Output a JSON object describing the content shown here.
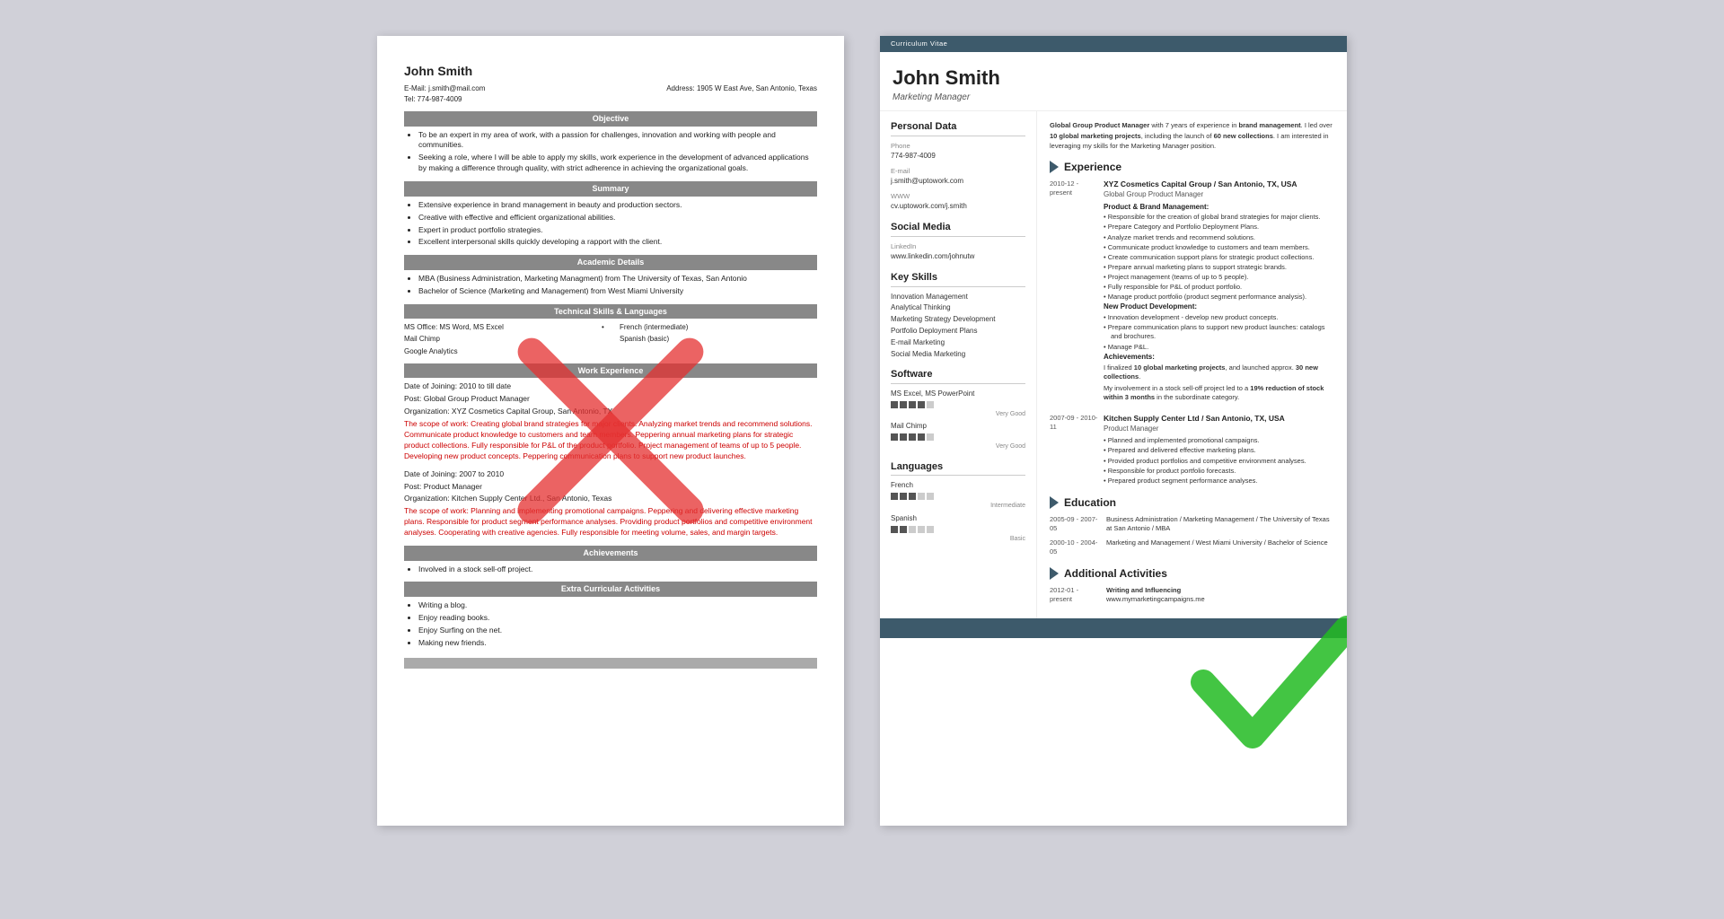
{
  "left_resume": {
    "name": "John Smith",
    "email": "E-Mail: j.smith@mail.com",
    "tel": "Tel: 774-987-4009",
    "address": "Address: 1905 W East Ave, San Antonio, Texas",
    "sections": {
      "objective": {
        "title": "Objective",
        "points": [
          "To be an expert in my area of work, with a passion for challenges, innovation and working with people and communities.",
          "Seeking a role, where I will be able to apply my skills, work experience in the development of advanced applications by making a difference through quality, with strict adherence in achieving the organizational goals."
        ]
      },
      "summary": {
        "title": "Summary",
        "points": [
          "Extensive experience in brand management in beauty and production sectors.",
          "Creative with effective and efficient organizational abilities.",
          "Expert in product portfolio strategies.",
          "Excellent interpersonal skills quickly developing a rapport with the client."
        ]
      },
      "academic": {
        "title": "Academic Details",
        "points": [
          "MBA (Business Administration, Marketing Managment) from The University of Texas, San Antonio",
          "Bachelor of Science (Marketing and Management) from West Miami University"
        ]
      },
      "skills": {
        "title": "Technical Skills & Languages",
        "col1": [
          "MS Office: MS Word, MS Excel",
          "Mail Chimp",
          "Google Analytics"
        ],
        "col2": [
          "French (intermediate)",
          "Spanish (basic)"
        ]
      },
      "work": {
        "title": "Work Experience",
        "jobs": [
          {
            "joining": "Date of Joining: 2010 to till date",
            "post": "Post: Global Group Product Manager",
            "org": "Organization: XYZ Cosmetics Capital Group, San Antonio, TX",
            "scope": "The scope of work: Creating global brand strategies for major clients. Analyzing market trends and recommend solutions. Communicate product knowledge to customers and team members. Peppering annual marketing plans for strategic product collections. Fully responsible for P&L of the product portfolio. Project management of teams of up to 5 people. Developing new product concepts. Peppering communication plans to support new product launches."
          },
          {
            "joining": "Date of Joining: 2007 to 2010",
            "post": "Post: Product Manager",
            "org": "Organization: Kitchen Supply Center Ltd., San Antonio, Texas",
            "scope": "The scope of work: Planning and implementing promotional campaigns. Peppering and delivering effective marketing plans. Responsible for product segment performance analyses. Providing product portfolios and competitive environment analyses. Cooperating with creative agencies. Fully responsible for meeting volume, sales, and margin targets."
          }
        ]
      },
      "achievements": {
        "title": "Achievements",
        "points": [
          "Involved in a stock sell-off project."
        ]
      },
      "extra": {
        "title": "Extra Curricular Activities",
        "points": [
          "Writing a blog.",
          "Enjoy reading books.",
          "Enjoy Surfing on the net.",
          "Making new friends."
        ]
      }
    }
  },
  "right_resume": {
    "cv_label": "Curriculum Vitae",
    "name": "John Smith",
    "title": "Marketing Manager",
    "intro": "Global Group Product Manager with 7 years of experience in brand management. I led over 10 global marketing projects, including the launch of 60 new collections. I am interested in leveraging my skills for the Marketing Manager position.",
    "personal_data": {
      "label": "Personal Data",
      "phone_label": "Phone",
      "phone": "774-987-4009",
      "email_label": "E-mail",
      "email": "j.smith@uptowork.com",
      "www_label": "WWW",
      "www": "cv.uptowork.com/j.smith"
    },
    "social": {
      "label": "Social Media",
      "linkedin_label": "LinkedIn",
      "linkedin": "www.linkedin.com/johnutw"
    },
    "skills": {
      "label": "Key Skills",
      "items": [
        "Innovation Management",
        "Analytical Thinking",
        "Marketing Strategy Development",
        "Portfolio Deployment Plans",
        "E-mail Marketing",
        "Social Media Marketing"
      ]
    },
    "software": {
      "label": "Software",
      "items": [
        {
          "name": "MS Excel, MS PowerPoint",
          "dots": 4,
          "total": 5,
          "level": "Very Good"
        },
        {
          "name": "Mail Chimp",
          "dots": 4,
          "total": 5,
          "level": "Very Good"
        }
      ]
    },
    "languages": {
      "label": "Languages",
      "items": [
        {
          "name": "French",
          "dots": 3,
          "total": 5,
          "level": "Intermediate"
        },
        {
          "name": "Spanish",
          "dots": 2,
          "total": 5,
          "level": "Basic"
        }
      ]
    },
    "experience": {
      "label": "Experience",
      "jobs": [
        {
          "date": "2010-12 - present",
          "company": "XYZ Cosmetics Capital Group / San Antonio, TX, USA",
          "role": "Global Group Product Manager",
          "sections": [
            {
              "subtitle": "Product & Brand Management:",
              "bullets": [
                "Responsible for the creation of global brand strategies for major clients.",
                "Prepare Category and Portfolio Deployment Plans.",
                "Analyze market trends and recommend solutions.",
                "Communicate product knowledge to customers and team members.",
                "Create communication support plans for strategic product collections.",
                "Prepare annual marketing plans to support strategic brands.",
                "Project management (teams of up to 5 people).",
                "Fully responsible for P&L of product portfolio.",
                "Manage product portfolio (product segment performance analysis)."
              ]
            },
            {
              "subtitle": "New Product Development:",
              "bullets": [
                "Innovation development - develop new product concepts.",
                "Prepare communication plans to support new product launches: catalogs and brochures.",
                "Manage P&L."
              ]
            },
            {
              "subtitle": "Achievements:",
              "text": "I finalized 10 global marketing projects, and launched approx. 30 new collections.",
              "text2": "My involvement in a stock sell-off project led to a 19% reduction of stock within 3 months in the subordinate category."
            }
          ]
        },
        {
          "date": "2007-09 - 2010-11",
          "company": "Kitchen Supply Center Ltd / San Antonio, TX, USA",
          "role": "Product Manager",
          "bullets": [
            "Planned and implemented promotional campaigns.",
            "Prepared and delivered effective marketing plans.",
            "Provided product portfolios and competitive environment analyses.",
            "Responsible for product portfolio forecasts.",
            "Prepared product segment performance analyses."
          ]
        }
      ]
    },
    "education": {
      "label": "Education",
      "items": [
        {
          "date": "2005-09 - 2007-05",
          "text": "Business Administration / Marketing Management / The University of Texas at San Antonio / MBA"
        },
        {
          "date": "2000-10 - 2004-05",
          "text": "Marketing and Management / West Miami University / Bachelor of Science"
        }
      ]
    },
    "activities": {
      "label": "Additional Activities",
      "items": [
        {
          "date": "2012-01 - present",
          "title": "Writing and Influencing",
          "text": "www.mymarketingcampaigns.me"
        }
      ]
    }
  }
}
